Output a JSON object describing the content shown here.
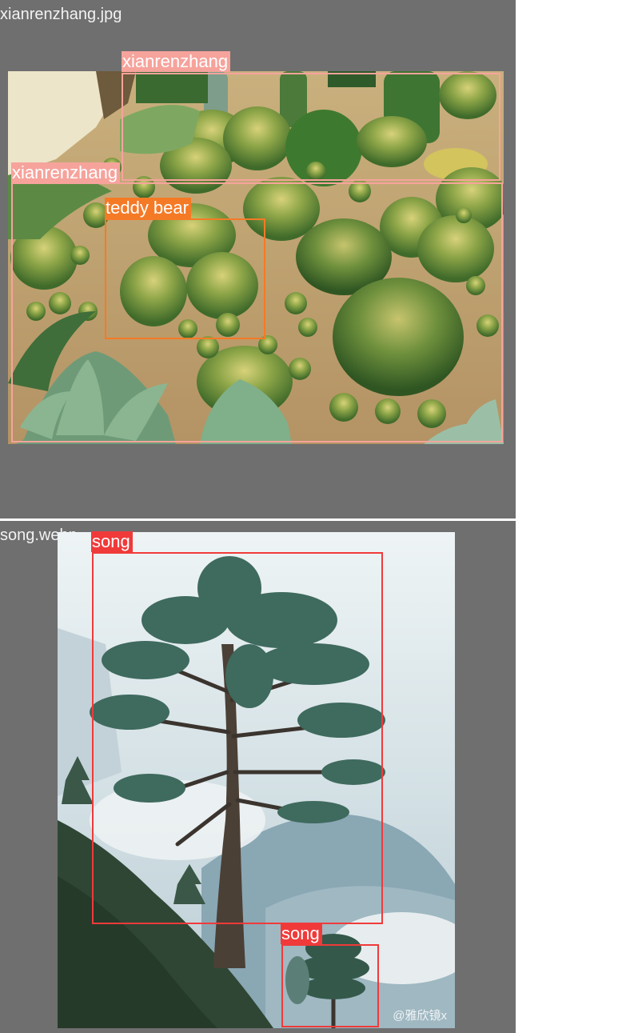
{
  "panels": [
    {
      "filename": "xianrenzhang.jpg",
      "detections": [
        {
          "label": "xianrenzhang",
          "color": "#f6a39c"
        },
        {
          "label": "xianrenzhang",
          "color": "#f6a39c"
        },
        {
          "label": "teddy bear",
          "color": "#f57a26"
        }
      ]
    },
    {
      "filename": "song.webp",
      "detections": [
        {
          "label": "song",
          "color": "#f03a3a"
        },
        {
          "label": "song",
          "color": "#f03a3a"
        }
      ],
      "watermark": "@雅欣镜x"
    }
  ],
  "colors": {
    "panel_bg": "#6f6f6f",
    "divider": "#ffffff"
  }
}
